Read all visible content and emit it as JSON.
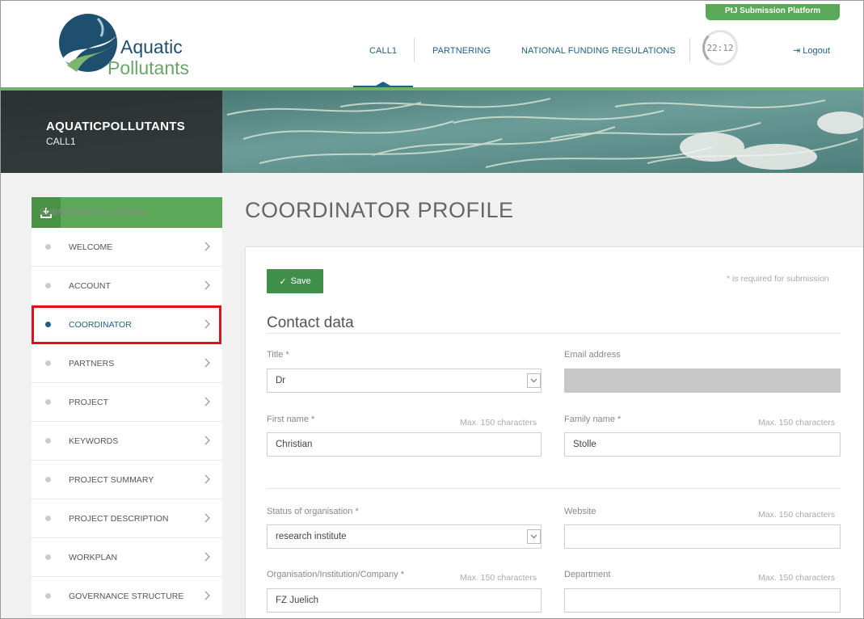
{
  "header": {
    "logo_line1": "Aquatic",
    "logo_line2": "Pollutants",
    "nav": [
      "CALL1",
      "PARTNERING",
      "NATIONAL FUNDING REGULATIONS"
    ],
    "timer": "22:12",
    "logout_label": "Logout",
    "platform_badge": "PtJ Submission Platform"
  },
  "banner": {
    "title": "AQUATICPOLLUTANTS",
    "subtitle": "CALL1"
  },
  "sidebar": {
    "header_label": "SUBMISSION PLATFORM",
    "items": [
      {
        "label": "WELCOME"
      },
      {
        "label": "ACCOUNT"
      },
      {
        "label": "COORDINATOR"
      },
      {
        "label": "PARTNERS"
      },
      {
        "label": "PROJECT"
      },
      {
        "label": "KEYWORDS"
      },
      {
        "label": "PROJECT SUMMARY"
      },
      {
        "label": "PROJECT DESCRIPTION"
      },
      {
        "label": "WORKPLAN"
      },
      {
        "label": "GOVERNANCE STRUCTURE"
      }
    ],
    "active_item": "COORDINATOR"
  },
  "main": {
    "page_title": "COORDINATOR PROFILE",
    "save_label": "Save",
    "required_note": "* is required for submission",
    "section_title": "Contact data",
    "fields": {
      "title": {
        "label": "Title *",
        "value": "Dr"
      },
      "email": {
        "label": "Email address",
        "value": ""
      },
      "first_name": {
        "label": "First name *",
        "hint": "Max. 150 characters",
        "value": "Christian"
      },
      "family_name": {
        "label": "Family name *",
        "hint": "Max. 150 characters",
        "value": "Stolle"
      },
      "status": {
        "label": "Status of organisation *",
        "value": "research institute"
      },
      "website": {
        "label": "Website",
        "hint": "Max. 150 characters",
        "value": ""
      },
      "organisation": {
        "label": "Organisation/Institution/Company *",
        "hint": "Max. 150 characters",
        "value": "FZ Juelich"
      },
      "department": {
        "label": "Department",
        "hint": "Max. 150 characters",
        "value": ""
      }
    }
  },
  "colors": {
    "brand_green": "#5aa858",
    "brand_blue": "#1f5f86",
    "highlight_red": "#e01020"
  }
}
